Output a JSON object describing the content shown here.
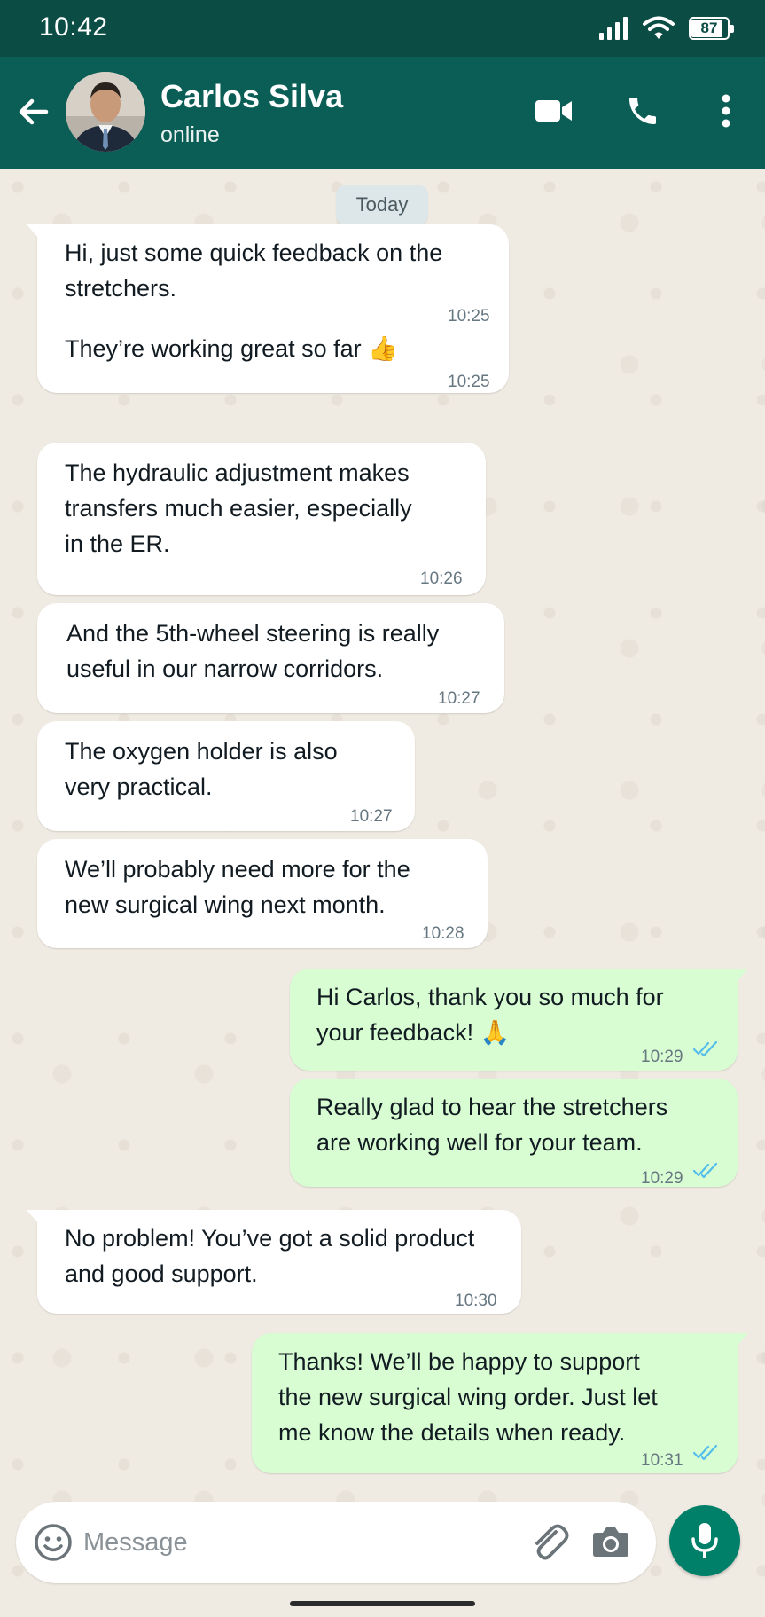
{
  "status_bar": {
    "time": "10:42",
    "battery": "87"
  },
  "header": {
    "contact_name": "Carlos Silva",
    "contact_status": "online"
  },
  "chat": {
    "date_label": "Today",
    "messages": [
      {
        "dir": "in",
        "text": "Hi, just some quick feedback on the\nstretchers.",
        "time": "10:25"
      },
      {
        "dir": "in",
        "text": "They’re working great so far 👍",
        "time": "10:25"
      },
      {
        "dir": "in",
        "text": "The hydraulic adjustment makes\ntransfers much easier, especially\nin the ER.",
        "time": "10:26"
      },
      {
        "dir": "in",
        "text": "And the 5th-wheel steering is really\nuseful in our narrow corridors.",
        "time": "10:27"
      },
      {
        "dir": "in",
        "text": "The oxygen holder is also\nvery practical.",
        "time": "10:27"
      },
      {
        "dir": "in",
        "text": "We’ll probably need more for the\nnew surgical wing next month.",
        "time": "10:28"
      },
      {
        "dir": "out",
        "text": "Hi Carlos, thank you so much for\nyour feedback! 🙏",
        "time": "10:29",
        "status": "read"
      },
      {
        "dir": "out",
        "text": "Really glad to hear the stretchers\nare working well for your team.",
        "time": "10:29",
        "status": "read"
      },
      {
        "dir": "in",
        "text": "No problem! You’ve got a solid product\nand good support.",
        "time": "10:30"
      },
      {
        "dir": "out",
        "text": "Thanks! We’ll be happy to support\nthe new surgical wing order. Just let\nme know the details when ready.",
        "time": "10:31",
        "status": "read"
      }
    ]
  },
  "input": {
    "placeholder": "Message"
  },
  "colors": {
    "header": "#0b5e55",
    "status_bar": "#0b4d45",
    "incoming_bubble": "#ffffff",
    "outgoing_bubble": "#d9fdd3",
    "accent": "#008069",
    "read_ticks": "#53bdeb",
    "chat_background": "#efeae2"
  },
  "icons": {
    "back": "arrow-left-icon",
    "video": "video-camera-icon",
    "call": "phone-icon",
    "menu": "kebab-menu-icon",
    "emoji": "smiley-icon",
    "attach": "paperclip-icon",
    "camera": "camera-icon",
    "mic": "microphone-icon"
  }
}
